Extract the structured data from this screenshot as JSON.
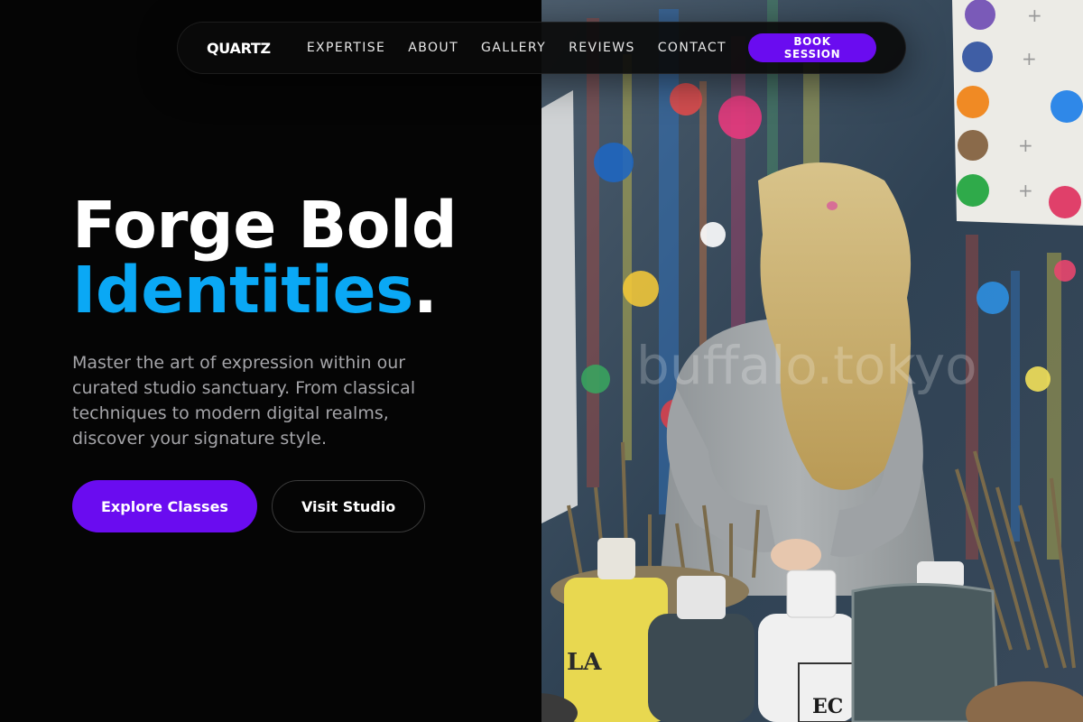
{
  "nav": {
    "brand": "QUARTZ",
    "links": [
      "EXPERTISE",
      "ABOUT",
      "GALLERY",
      "REVIEWS",
      "CONTACT"
    ],
    "cta": "BOOK SESSION"
  },
  "hero": {
    "title_line1": "Forge Bold",
    "title_line2": "Identities",
    "title_dot": ".",
    "subtitle": "Master the art of expression within our curated studio sanctuary. From classical techniques to modern digital realms, discover your signature style.",
    "primary_button": "Explore Classes",
    "secondary_button": "Visit Studio"
  },
  "photo": {
    "watermark": "buffalo.tokyo",
    "jar_label_left": "LA",
    "jar_label_right": "EC"
  },
  "colors": {
    "accent_purple": "#6a0cf0",
    "accent_blue": "#0aa8f5",
    "background": "#050505"
  }
}
